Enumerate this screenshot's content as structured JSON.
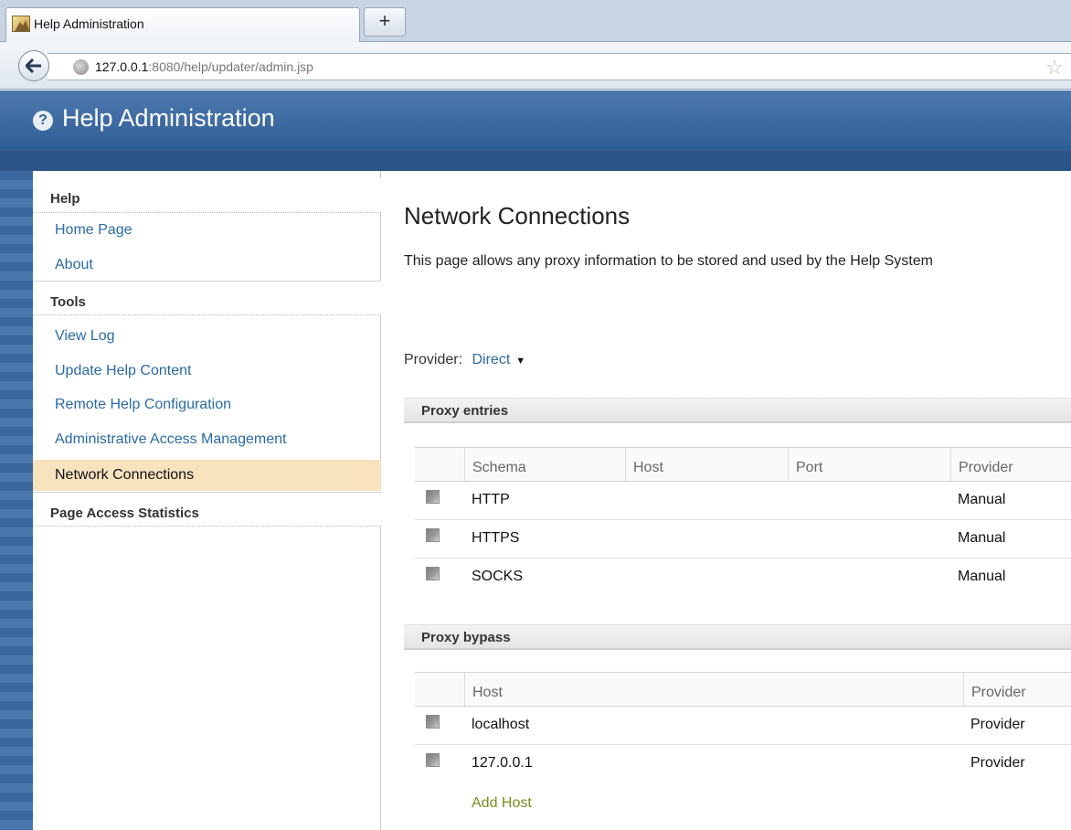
{
  "browser": {
    "tab_title": "Help Administration",
    "new_tab_label": "+",
    "url_host": "127.0.0.1",
    "url_rest": ":8080/help/updater/admin.jsp"
  },
  "app": {
    "title": "Help Administration",
    "help_icon_glyph": "?",
    "colors": {
      "header": "#2f5d96",
      "active_item": "#f8e3bf",
      "link": "#2a6aa5",
      "add_link": "#7a8a22"
    }
  },
  "sidebar": {
    "help_heading": "Help",
    "help_items": [
      "Home Page",
      "About"
    ],
    "tools_heading": "Tools",
    "tools_items": [
      "View Log",
      "Update Help Content",
      "Remote Help Configuration",
      "Administrative Access Management",
      "Network Connections"
    ],
    "active_item": "Network Connections",
    "stats_heading": "Page Access Statistics"
  },
  "main": {
    "title": "Network Connections",
    "description": "This page allows any proxy information to be stored and used by the Help System",
    "provider_label": "Provider:",
    "provider_value": "Direct",
    "proxy_entries": {
      "heading": "Proxy entries",
      "columns": [
        "Schema",
        "Host",
        "Port",
        "Provider"
      ],
      "rows": [
        {
          "schema": "HTTP",
          "host": "",
          "port": "",
          "provider": "Manual"
        },
        {
          "schema": "HTTPS",
          "host": "",
          "port": "",
          "provider": "Manual"
        },
        {
          "schema": "SOCKS",
          "host": "",
          "port": "",
          "provider": "Manual"
        }
      ]
    },
    "proxy_bypass": {
      "heading": "Proxy bypass",
      "columns": [
        "Host",
        "Provider"
      ],
      "rows": [
        {
          "host": "localhost",
          "provider": "Provider"
        },
        {
          "host": "127.0.0.1",
          "provider": "Provider"
        }
      ],
      "add_label": "Add Host"
    }
  }
}
